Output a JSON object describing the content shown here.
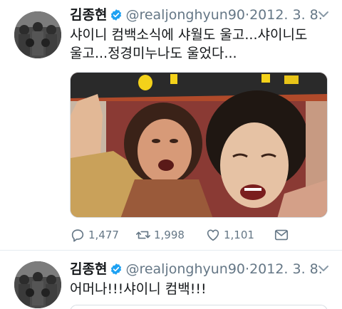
{
  "tweets": [
    {
      "display_name": "김종현",
      "handle": "@realjonghyun90",
      "separator": "·",
      "date": "2012. 3. 8.",
      "text_line1": "샤이니 컴백소식에 샤월도 울고...샤이니도",
      "text_line2": "울고...정경미누나도 울었다...",
      "replies": "1,477",
      "retweets": "1,998",
      "likes": "1,101",
      "icons": [
        "verified-icon",
        "chevron-down-icon",
        "reply-icon",
        "retweet-icon",
        "like-icon",
        "message-icon"
      ]
    },
    {
      "display_name": "김종현",
      "handle": "@realjonghyun90",
      "separator": "·",
      "date": "2012. 3. 8.",
      "text_line1": "어머나!!!샤이니 컴백!!!"
    }
  ],
  "colors": {
    "verified": "#1da1f2",
    "secondary_text": "#657786",
    "divider": "#e6ecf0"
  }
}
